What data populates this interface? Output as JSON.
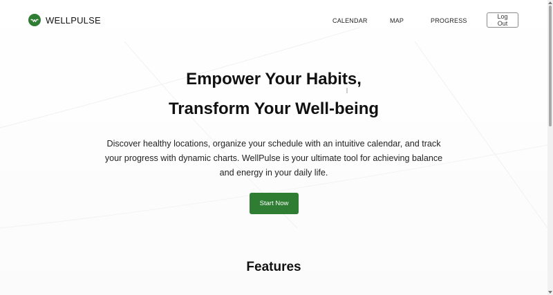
{
  "brand": {
    "name": "WELLPULSE",
    "logo_icon": "wellpulse-logo-icon",
    "color": "#2e7d32"
  },
  "nav": {
    "items": [
      {
        "label": "CALENDAR"
      },
      {
        "label": "MAP"
      },
      {
        "label": "PROGRESS"
      }
    ],
    "logout_label": "Log Out"
  },
  "hero": {
    "title_line1": "Empower Your Habits,",
    "title_line2": "Transform Your Well-being",
    "description": "Discover healthy locations, organize your schedule with an intuitive calendar, and track your progress with dynamic charts. WellPulse is your ultimate tool for achieving balance and energy in your daily life.",
    "cta_label": "Start Now",
    "cta_color": "#2e7d32"
  },
  "features": {
    "title": "Features"
  }
}
